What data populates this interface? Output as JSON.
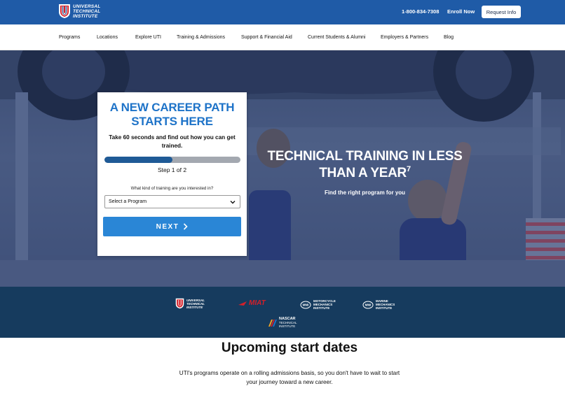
{
  "header": {
    "logo_lines": [
      "UNIVERSAL",
      "TECHNICAL",
      "INSTITUTE"
    ],
    "phone": "1-800-834-7308",
    "enroll_label": "Enroll Now",
    "request_label": "Request Info"
  },
  "nav": {
    "items": [
      "Programs",
      "Locations",
      "Explore UTI",
      "Training & Admissions",
      "Support & Financial Aid",
      "Current Students & Alumni",
      "Employers & Partners",
      "Blog"
    ]
  },
  "form": {
    "title_line1": "A NEW CAREER PATH",
    "title_line2": "STARTS HERE",
    "description": "Take 60 seconds and find out how you can get trained.",
    "progress_fraction": 0.5,
    "step_text": "Step 1 of 2",
    "question": "What kind of training are you interested in?",
    "select_value": "Select a Program",
    "next_label": "NEXT"
  },
  "hero": {
    "title_line1": "TECHNICAL TRAINING IN LESS",
    "title_line2": "THAN A YEAR",
    "title_sup": "7",
    "subtitle": "Find the right program for you"
  },
  "brands": {
    "uti": [
      "UNIVERSAL",
      "TECHNICAL",
      "INSTITUTE"
    ],
    "miat": "MIAT",
    "mmi_moto": [
      "MOTORCYCLE",
      "MECHANICS",
      "INSTITUTE"
    ],
    "mmi_marine": [
      "MARINE",
      "MECHANICS",
      "INSTITUTE"
    ],
    "nascar": [
      "NASCAR",
      "TECHNICAL",
      "INSTITUTE"
    ]
  },
  "start_dates": {
    "title": "Upcoming start dates",
    "text": "UTI's programs operate on a rolling admissions basis, so you don't have to wait to start your journey toward a new career."
  },
  "colors": {
    "brand_blue": "#1f5ba7",
    "accent_blue": "#1e73c8",
    "button_blue": "#2a86d6",
    "band_navy": "#163b5e"
  }
}
